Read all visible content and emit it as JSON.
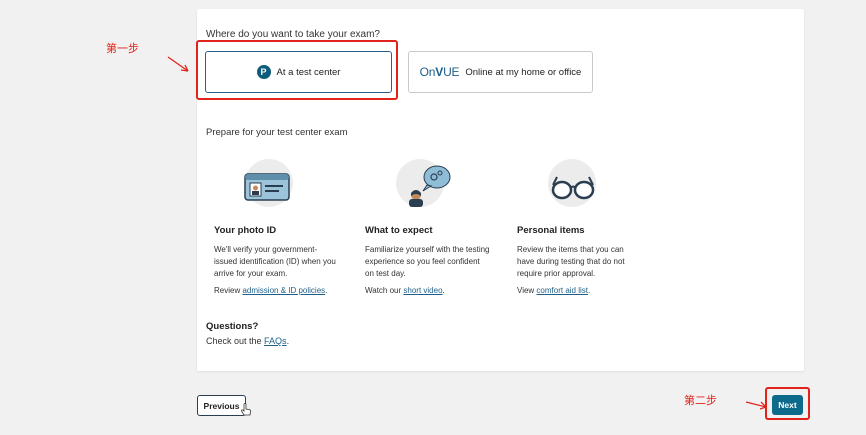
{
  "main": {
    "question": "Where do you want to take your exam?",
    "options": [
      {
        "label": "At a test center",
        "icon": "pearson-p-icon",
        "icon_text": "P"
      },
      {
        "label": "Online at my home or office",
        "logo_prefix": "On",
        "logo_suffix": "UE",
        "logo_v": "V"
      }
    ],
    "prepare_heading": "Prepare for your test center exam",
    "info": [
      {
        "title": "Your photo ID",
        "desc": "We'll verify your government-issued identification (ID) when you arrive for your exam.",
        "link_prefix": "Review ",
        "link_text": "admission & ID policies",
        "link_suffix": ".",
        "icon": "id-card-icon"
      },
      {
        "title": "What to expect",
        "desc": "Familiarize yourself with the testing experience so you feel confident on test day.",
        "link_prefix": "Watch our ",
        "link_text": "short video",
        "link_suffix": ".",
        "icon": "video-person-icon"
      },
      {
        "title": "Personal items",
        "desc": "Review the items that you can have during testing that do not require prior approval.",
        "link_prefix": "View ",
        "link_text": "comfort aid list",
        "link_suffix": ".",
        "icon": "glasses-icon"
      }
    ],
    "questions_title": "Questions?",
    "questions_prefix": "Check out the ",
    "questions_link": "FAQs",
    "questions_suffix": "."
  },
  "footer": {
    "previous_label": "Previous",
    "next_label": "Next"
  },
  "annotations": {
    "step1": "第一步",
    "step2": "第二步"
  },
  "colors": {
    "accent": "#0d6a8a",
    "annotation": "#e0231b",
    "link": "#1d5f8a"
  }
}
